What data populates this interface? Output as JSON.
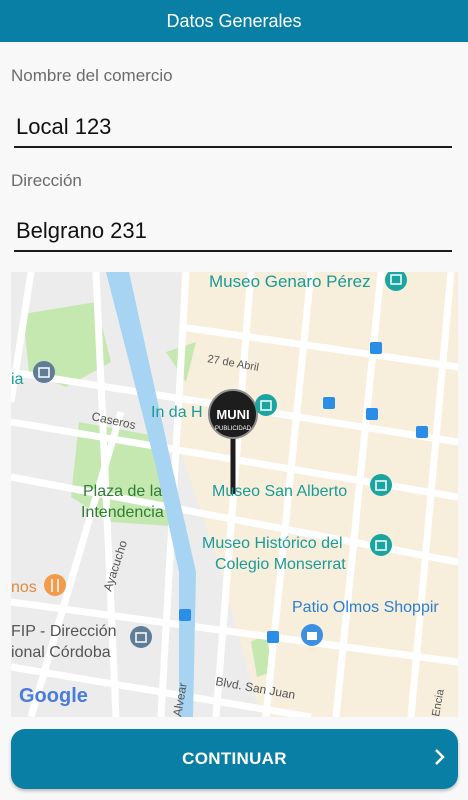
{
  "header": {
    "title": "Datos Generales"
  },
  "form": {
    "name_label": "Nombre del comercio",
    "name_value": "Local 123",
    "address_label": "Dirección",
    "address_value": "Belgrano 231"
  },
  "map": {
    "pin_text_top": "MUNI",
    "pin_text_bottom": "PUBLICIDAD",
    "labels": {
      "museo_genaro": "Museo Genaro Pérez",
      "calle_27_abril": "27 de Abril",
      "ia": "ia",
      "caseros": "Caseros",
      "in_da_h": "In da H",
      "plaza_1": "Plaza de la",
      "plaza_2": "Intendencia",
      "museo_san_alberto": "Museo San Alberto",
      "museo_hist_1": "Museo Histórico del",
      "museo_hist_2": "Colegio Monserrat",
      "ayacucho": "Ayacucho",
      "nos": "nos",
      "patio_olmos": "Patio Olmos Shoppir",
      "fip_1": "FIP - Dirección",
      "fip_2": "ional Córdoba",
      "alvear": "Alvear",
      "blvd_san_juan": "Blvd. San Juan",
      "encia": "Encia",
      "google": "Google"
    }
  },
  "actions": {
    "continue_label": "CONTINUAR"
  },
  "colors": {
    "primary": "#0a7fa5",
    "map_beige": "#f8eedc",
    "map_green": "#c5e8b0",
    "map_gray": "#ececec"
  }
}
